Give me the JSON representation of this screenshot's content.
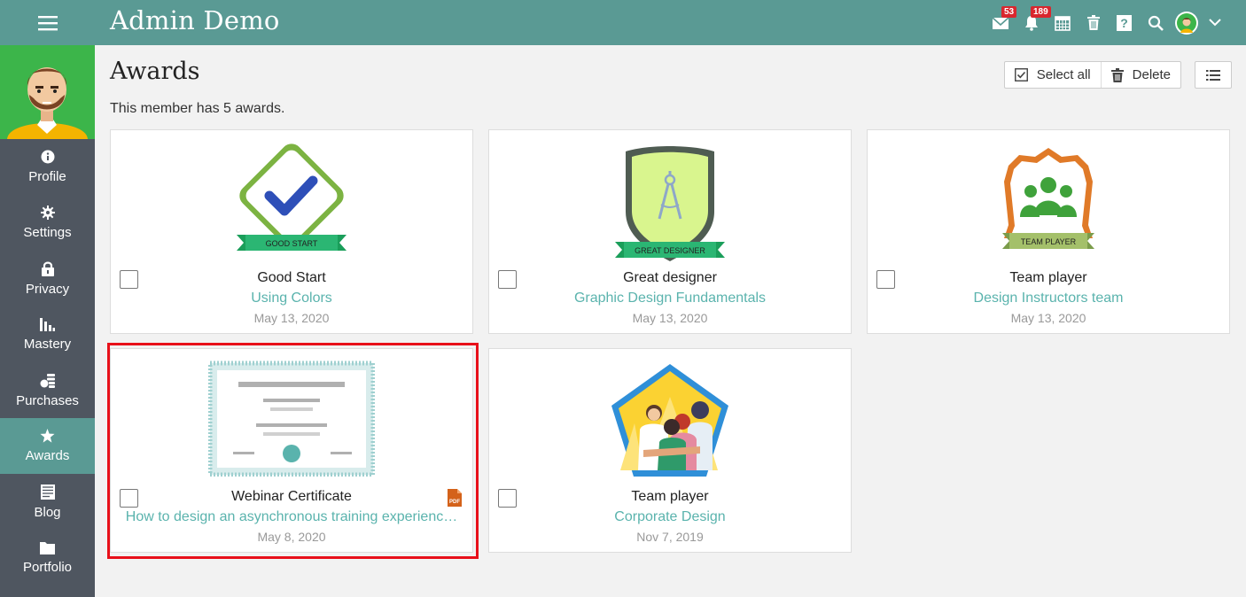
{
  "header": {
    "app_title": "Admin Demo",
    "menu_icon": "hamburger-icon",
    "messages_badge": "53",
    "notifications_badge": "189",
    "icons": [
      "menu-icon",
      "envelope-icon",
      "bell-icon",
      "calendar-icon",
      "trash-icon",
      "help-icon",
      "search-icon",
      "user-avatar",
      "chevron-down-icon"
    ]
  },
  "sidebar": {
    "items": [
      {
        "label": "Profile",
        "icon": "info-icon"
      },
      {
        "label": "Settings",
        "icon": "gear-icon"
      },
      {
        "label": "Privacy",
        "icon": "lock-icon"
      },
      {
        "label": "Mastery",
        "icon": "bar-chart-icon"
      },
      {
        "label": "Purchases",
        "icon": "coins-icon"
      },
      {
        "label": "Awards",
        "icon": "star-icon",
        "active": true
      },
      {
        "label": "Blog",
        "icon": "blog-icon"
      },
      {
        "label": "Portfolio",
        "icon": "folder-icon"
      }
    ]
  },
  "page": {
    "title": "Awards",
    "subtitle": "This member has 5 awards.",
    "select_all_label": "Select all",
    "delete_label": "Delete"
  },
  "awards": [
    {
      "name": "Good Start",
      "course": "Using Colors",
      "date": "May 13, 2020",
      "ribbon": "GOOD START"
    },
    {
      "name": "Great designer",
      "course": "Graphic Design Fundamentals",
      "date": "May 13, 2020",
      "ribbon": "GREAT DESIGNER"
    },
    {
      "name": "Team player",
      "course": "Design Instructors team",
      "date": "May 13, 2020",
      "ribbon": "TEAM PLAYER"
    },
    {
      "name": "Webinar Certificate",
      "course": "How to design an asynchronous training experienc…",
      "date": "May 8, 2020",
      "file_icon": "pdf-icon",
      "highlighted": true
    },
    {
      "name": "Team player",
      "course": "Corporate Design",
      "date": "Nov 7, 2019"
    }
  ],
  "colors": {
    "topbar": "#5a9a94",
    "sidebar": "#4f5660",
    "accent_link": "#5ab3ad",
    "highlight": "#e8101a",
    "badge": "#d9272e"
  }
}
